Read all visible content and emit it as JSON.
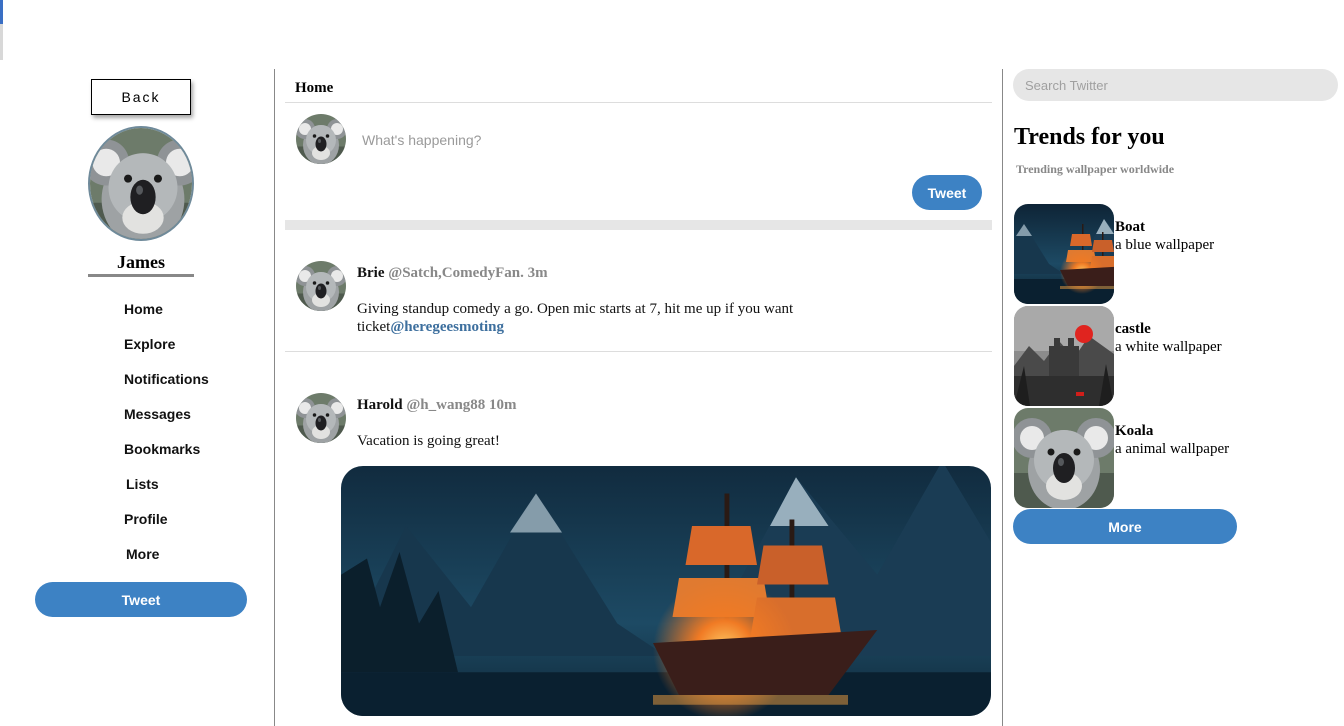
{
  "sidebar": {
    "back_label": "Back",
    "user_name": "James",
    "nav": [
      "Home",
      "Explore",
      "Notifications",
      "Messages",
      "Bookmarks",
      "Lists",
      "Profile",
      "More"
    ],
    "tweet_button": "Tweet"
  },
  "main": {
    "title": "Home",
    "compose_placeholder": "What's happening?",
    "tweet_button": "Tweet",
    "tweets": [
      {
        "author": "Brie",
        "meta": "@Satch,ComedyFan. 3m",
        "text": "Giving standup comedy a go. Open mic starts at 7, hit me up if you want ticket",
        "mention": "@heregeesmoting"
      },
      {
        "author": "Harold",
        "meta": "@h_wang88 10m",
        "text": "Vacation is going great!"
      }
    ]
  },
  "right": {
    "search_placeholder": "Search Twitter",
    "trends_title": "Trends for you",
    "trends_subtitle": "Trending wallpaper worldwide",
    "trends": [
      {
        "name": "Boat",
        "desc": "a blue wallpaper"
      },
      {
        "name": "castle",
        "desc": "a white wallpaper"
      },
      {
        "name": "Koala",
        "desc": "a animal wallpaper"
      }
    ],
    "more_button": "More"
  },
  "colors": {
    "accent": "#3d82c4",
    "mention": "#3d6f9e",
    "muted": "#888888"
  }
}
